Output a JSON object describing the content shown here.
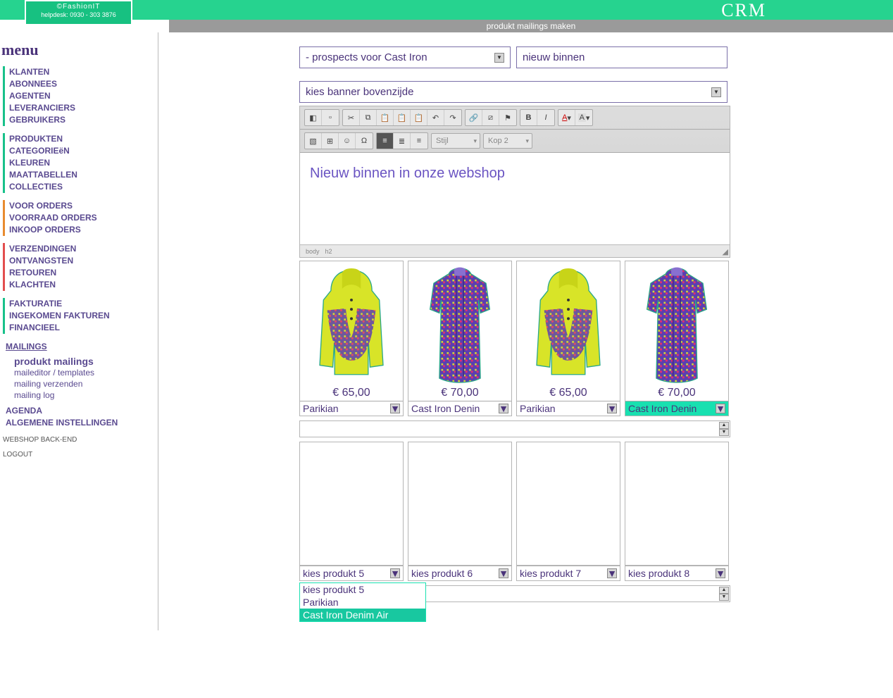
{
  "brand": {
    "name": "©FashionIT",
    "helpdesk": "helpdesk: 0930 - 303 3876"
  },
  "app_title": "CRM",
  "subheader": "produkt mailings maken",
  "menu_title": "menu",
  "sidebar": {
    "g1": [
      "KLANTEN",
      "ABONNEES",
      "AGENTEN",
      "LEVERANCIERS",
      "GEBRUIKERS"
    ],
    "g2": [
      "PRODUKTEN",
      "CATEGORIEëN",
      "KLEUREN",
      "MAATTABELLEN",
      "COLLECTIES"
    ],
    "g3": [
      "VOOR ORDERS",
      "VOORRAAD ORDERS",
      "INKOOP ORDERS"
    ],
    "g4": [
      "VERZENDINGEN",
      "ONTVANGSTEN",
      "RETOUREN",
      "KLACHTEN"
    ],
    "g5": [
      "FAKTURATIE",
      "INGEKOMEN FAKTUREN",
      "FINANCIEEL"
    ],
    "mailings": "MAILINGS",
    "sub": [
      "produkt mailings",
      "maileditor / templates",
      "mailing verzenden",
      "mailing log"
    ],
    "g6": [
      "AGENDA",
      "ALGEMENE INSTELLINGEN"
    ],
    "backend": "WEBSHOP BACK-END",
    "logout": "LOGOUT"
  },
  "form": {
    "prospects": "- prospects voor Cast Iron",
    "subject": "nieuw binnen",
    "banner": "kies banner bovenzijde"
  },
  "editor": {
    "style_label": "Stijl",
    "format_label": "Kop 2",
    "path1": "body",
    "path2": "h2",
    "content": "Nieuw binnen in onze webshop"
  },
  "products": {
    "row1": [
      {
        "price": "€ 65,00",
        "name": "Parikian",
        "type": "hood"
      },
      {
        "price": "€ 70,00",
        "name": "Cast Iron Denin",
        "type": "shirt"
      },
      {
        "price": "€ 65,00",
        "name": "Parikian",
        "type": "hood"
      },
      {
        "price": "€ 70,00",
        "name": "Cast Iron Denin",
        "type": "shirt",
        "hl": true
      }
    ],
    "row2": [
      {
        "name": "kies produkt 5"
      },
      {
        "name": "kies produkt 6"
      },
      {
        "name": "kies produkt 7"
      },
      {
        "name": "kies produkt 8"
      }
    ]
  },
  "dropdown": {
    "options": [
      "kies produkt 5",
      "Parikian",
      "Cast Iron Denim Air"
    ],
    "selected": 2
  }
}
